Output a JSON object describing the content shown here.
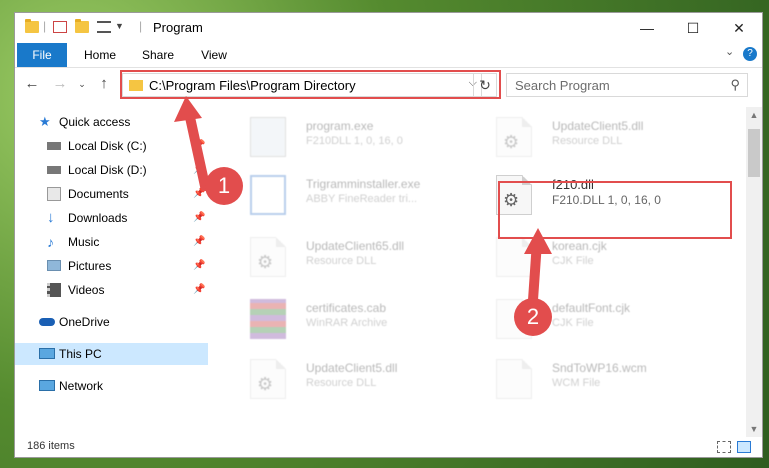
{
  "window": {
    "title": "Program",
    "controls": {
      "minimize": "—",
      "maximize": "☐",
      "close": "✕"
    }
  },
  "ribbon": {
    "tabs": [
      "File",
      "Home",
      "Share",
      "View"
    ],
    "help": "?"
  },
  "address": {
    "path": "C:\\Program Files\\Program Directory",
    "dropdown": "⌵",
    "refresh": "↻"
  },
  "search": {
    "placeholder": "Search Program",
    "icon": "⚲"
  },
  "sidebar": {
    "items": [
      {
        "label": "Quick access",
        "icon": "star-icon"
      },
      {
        "label": "Local Disk (C:)",
        "icon": "drive-icon",
        "pinned": true
      },
      {
        "label": "Local Disk (D:)",
        "icon": "drive-icon",
        "pinned": true
      },
      {
        "label": "Documents",
        "icon": "documents-icon",
        "pinned": true
      },
      {
        "label": "Downloads",
        "icon": "download-icon",
        "pinned": true
      },
      {
        "label": "Music",
        "icon": "music-icon",
        "pinned": true
      },
      {
        "label": "Pictures",
        "icon": "pictures-icon",
        "pinned": true
      },
      {
        "label": "Videos",
        "icon": "videos-icon",
        "pinned": true
      },
      {
        "label": "OneDrive",
        "icon": "cloud-icon"
      },
      {
        "label": "This PC",
        "icon": "pc-icon",
        "selected": true
      },
      {
        "label": "Network",
        "icon": "network-icon"
      }
    ]
  },
  "files": [
    {
      "name": "program.exe",
      "meta": "F210DLL 1, 0, 16, 0"
    },
    {
      "name": "UpdateClient5.dll",
      "meta": "Resource DLL"
    },
    {
      "name": "Trigramminstaller.exe",
      "meta": "ABBY FineReader tri..."
    },
    {
      "name": "f210.dll",
      "meta": "F210.DLL 1, 0, 16, 0"
    },
    {
      "name": "UpdateClient65.dll",
      "meta": "Resource DLL"
    },
    {
      "name": "korean.cjk",
      "meta": "CJK File"
    },
    {
      "name": "certificates.cab",
      "meta": "WinRAR Archive"
    },
    {
      "name": "defaultFont.cjk",
      "meta": "CJK File"
    },
    {
      "name": "UpdateClient5.dll",
      "meta": "Resource DLL"
    },
    {
      "name": "SndToWP16.wcm",
      "meta": "WCM File"
    }
  ],
  "annotations": {
    "step1": "1",
    "step2": "2"
  },
  "status": {
    "items_count": "186 items"
  },
  "colors": {
    "accent": "#1979ca",
    "annotation_red": "#e24d4d",
    "selection": "#cce8ff"
  }
}
